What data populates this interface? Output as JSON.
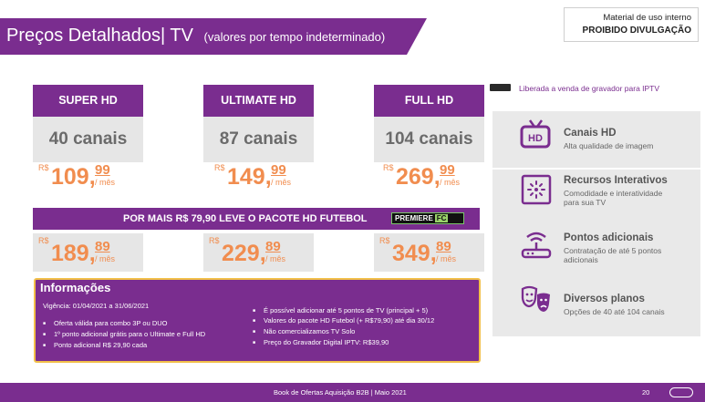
{
  "header": {
    "title": "Preços Detalhados",
    "separator": "|",
    "section": "TV",
    "subtitle": "(valores por tempo indeterminado)",
    "badge_line1": "Material de uso interno",
    "badge_line2": "PROIBIDO DIVULGAÇÃO"
  },
  "plans": [
    {
      "name": "SUPER HD",
      "channels": "40 canais",
      "currency": "R$",
      "int": "109,",
      "dec": "99",
      "per": "/ mês",
      "futebol": {
        "currency": "R$",
        "int": "189,",
        "dec": "89",
        "per": "/ mês"
      }
    },
    {
      "name": "ULTIMATE HD",
      "channels": "87 canais",
      "currency": "R$",
      "int": "149,",
      "dec": "99",
      "per": "/ mês",
      "futebol": {
        "currency": "R$",
        "int": "229,",
        "dec": "89",
        "per": "/ mês"
      }
    },
    {
      "name": "FULL HD",
      "channels": "104 canais",
      "currency": "R$",
      "int": "269,",
      "dec": "99",
      "per": "/ mês",
      "futebol": {
        "currency": "R$",
        "int": "349,",
        "dec": "89",
        "per": "/ mês"
      }
    }
  ],
  "futebol": {
    "text": "POR MAIS R$ 79,90 LEVE O PACOTE HD FUTEBOL",
    "logo": "PREMIERE",
    "logo_fc": "FC"
  },
  "info": {
    "title": "Informações",
    "vigencia": "Vigência: 01/04/2021 a 31/06/2021",
    "left": [
      "Oferta válida para combo 3P ou DUO",
      "1º ponto adicional grátis para o Ultimate e Full HD",
      "Ponto adicional R$ 29,90 cada"
    ],
    "right": [
      "É possível adicionar até 5 pontos de TV (principal + 5)",
      "Valores do pacote  HD Futebol  (+ R$79,90) até dia 30/12",
      "Não comercializamos TV Solo",
      "Preço do Gravador Digital IPTV: R$39,90"
    ]
  },
  "side": {
    "recorder_note": "Liberada a venda de gravador para IPTV",
    "features": [
      {
        "icon": "hd-tv-icon",
        "title": "Canais HD",
        "sub": [
          "Alta qualidade de imagem"
        ]
      },
      {
        "icon": "interactive-icon",
        "title": "Recursos Interativos",
        "sub": [
          "Comodidade e interatividade",
          "para sua TV"
        ]
      },
      {
        "icon": "router-icon",
        "title": "Pontos adicionais",
        "sub": [
          "Contratação de até  5 pontos",
          "adicionais"
        ]
      },
      {
        "icon": "theater-masks-icon",
        "title": "Diversos planos",
        "sub": [
          "Opções de 40 até 104 canais"
        ]
      }
    ]
  },
  "footer": {
    "text": "Book de Ofertas Aquisição B2B | Maio 2021",
    "page": "20"
  },
  "colors": {
    "brand": "#7a2d8f",
    "price": "#f18d4f",
    "box": "#e6e6e6",
    "info_border": "#f2c04a"
  }
}
